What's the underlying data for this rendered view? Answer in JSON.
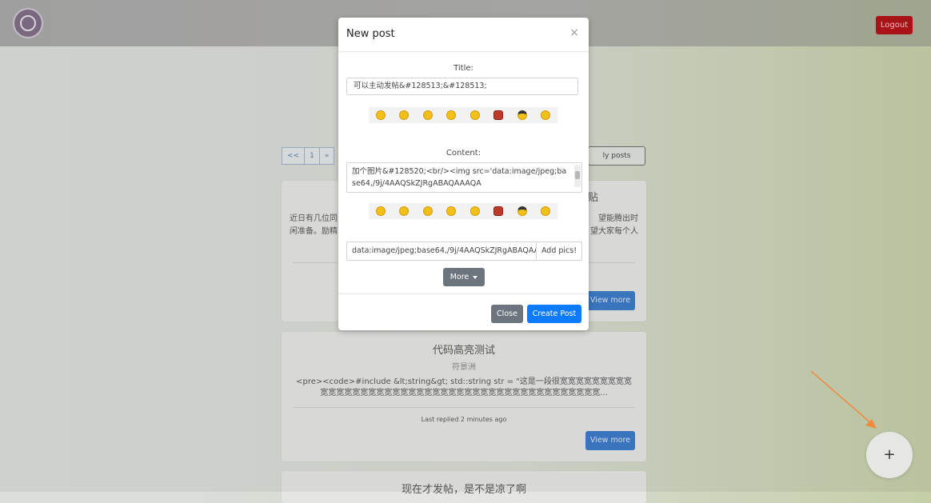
{
  "navbar": {
    "logout_label": "Logout"
  },
  "background": {
    "pagination": [
      "<<",
      "1",
      "»"
    ],
    "my_posts_label": "ly posts",
    "card1": {
      "title_left": "【",
      "title_right": "贴",
      "body_left": "近日有几位同\n闲准备。励精",
      "body_right": "望能腾出时\n望大家每个人",
      "view_more": "View more"
    },
    "card2": {
      "title": "代码高亮测试",
      "author": "符景洲",
      "body": "<pre><code>#include &lt;string&gt; std::string str = \"这是一段很宽宽宽宽宽宽宽宽宽宽宽宽宽宽宽宽宽宽宽宽宽宽宽宽宽宽宽宽宽宽宽宽宽宽宽宽宽宽宽宽宽宽宽宽...",
      "replied": "Last replied 2 minutes ago",
      "view_more": "View more"
    },
    "card3": {
      "title": "现在才发帖，是不是凉了啊"
    }
  },
  "modal": {
    "title": "New post",
    "close_glyph": "×",
    "title_label": "Title:",
    "title_value": "可以主动发帖&#128513;&#128513;",
    "content_label": "Content:",
    "content_value": "加个图片&#128520;<br/><img src='data:image/jpeg;base64,/9j/4AAQSkZJRgABAQAAAQA",
    "pic_value": "data:image/jpeg;base64,/9j/4AAQSkZJRgABAQAA",
    "add_pics_label": "Add pics!",
    "more_label": "More",
    "close_label": "Close",
    "create_label": "Create Post"
  },
  "fab": {
    "label": "+"
  },
  "colors": {
    "accent": "#0d7bff",
    "logout": "#b50f15",
    "arrow": "#f08a3c"
  }
}
